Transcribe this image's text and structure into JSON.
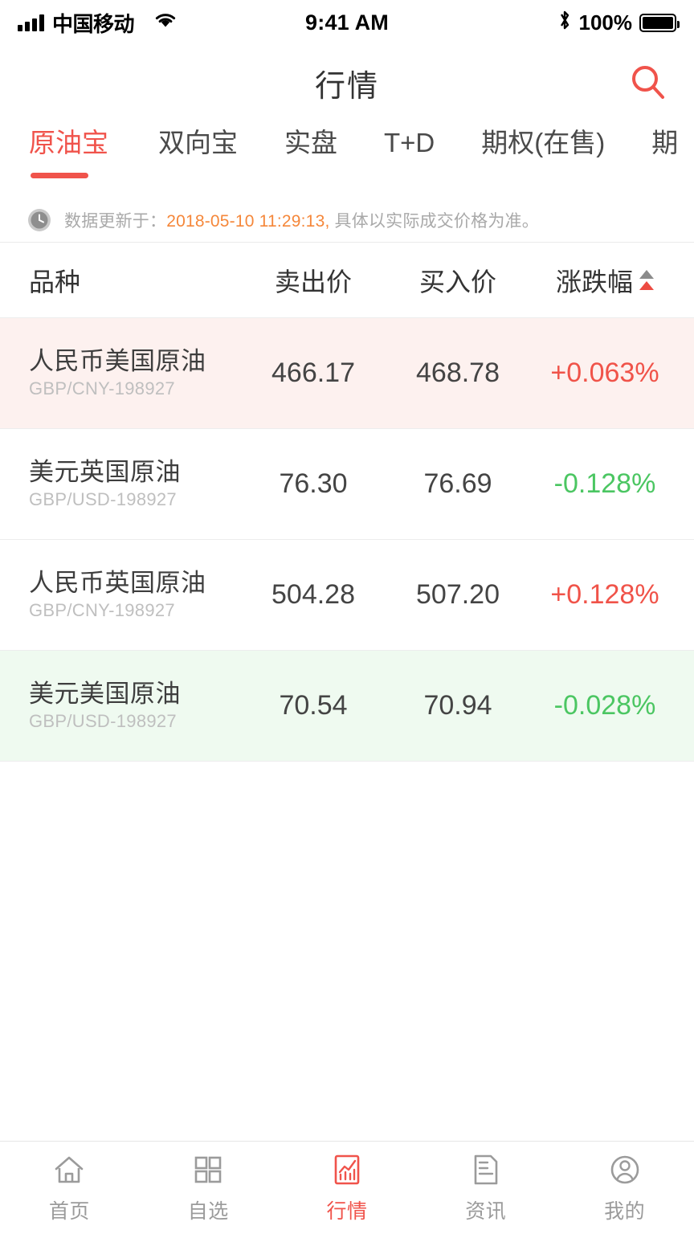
{
  "status_bar": {
    "carrier": "中国移动",
    "time": "9:41 AM",
    "battery_pct": "100%",
    "icons": [
      "signal-icon",
      "wifi-icon",
      "bluetooth-icon",
      "battery-icon"
    ]
  },
  "header": {
    "title": "行情",
    "search_icon": "search-icon"
  },
  "tabs": {
    "active_index": 0,
    "items": [
      {
        "label": "原油宝"
      },
      {
        "label": "双向宝"
      },
      {
        "label": "实盘"
      },
      {
        "label": "T+D"
      },
      {
        "label": "期权(在售)"
      },
      {
        "label": "期"
      }
    ]
  },
  "info_bar": {
    "icon": "clock-icon",
    "prefix": "数据更新于：",
    "timestamp": "2018-05-10 11:29:13,",
    "suffix": "具体以实际成交价格为准。"
  },
  "table": {
    "headers": {
      "name": "品种",
      "sell": "卖出价",
      "buy": "买入价",
      "change": "涨跌幅"
    },
    "sort_indicator": "sort-triangles-icon",
    "rows": [
      {
        "name": "人民币美国原油",
        "code": "GBP/CNY-198927",
        "sell": "466.17",
        "buy": "468.78",
        "change": "+0.063%",
        "direction": "up"
      },
      {
        "name": "美元英国原油",
        "code": "GBP/USD-198927",
        "sell": "76.30",
        "buy": "76.69",
        "change": "-0.128%",
        "direction": "down"
      },
      {
        "name": "人民币英国原油",
        "code": "GBP/CNY-198927",
        "sell": "504.28",
        "buy": "507.20",
        "change": "+0.128%",
        "direction": "up"
      },
      {
        "name": "美元美国原油",
        "code": "GBP/USD-198927",
        "sell": "70.54",
        "buy": "70.94",
        "change": "-0.028%",
        "direction": "down"
      }
    ]
  },
  "bottom_nav": {
    "active_index": 2,
    "items": [
      {
        "label": "首页",
        "icon": "home-icon"
      },
      {
        "label": "自选",
        "icon": "grid-icon"
      },
      {
        "label": "行情",
        "icon": "chart-icon"
      },
      {
        "label": "资讯",
        "icon": "news-icon"
      },
      {
        "label": "我的",
        "icon": "user-icon"
      }
    ]
  },
  "colors": {
    "accent_red": "#F0534B",
    "up_red": "#F05349",
    "down_green": "#4BC662",
    "row_up_bg": "#FDF1EF",
    "row_down_bg": "#EFFAF0",
    "timestamp_orange": "#F5873A"
  }
}
